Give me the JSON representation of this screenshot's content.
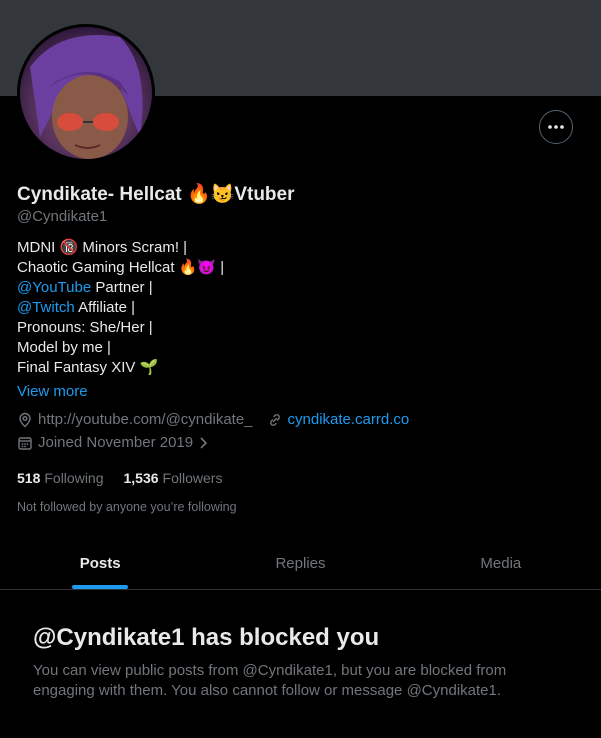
{
  "profile": {
    "display_name": "Cyndikate- Hellcat 🔥😼Vtuber",
    "handle": "@Cyndikate1",
    "bio": {
      "line1": "MDNI 🔞 Minors Scram! |",
      "line2": "Chaotic Gaming Hellcat 🔥😈 |",
      "line3_link": "@YouTube",
      "line3_rest": " Partner |",
      "line4_link": "@Twitch",
      "line4_rest": " Affiliate |",
      "line5": "Pronouns: She/Her |",
      "line6": "Model by me |",
      "line7": "Final Fantasy XIV 🌱"
    },
    "view_more": "View more",
    "website_text": "http://youtube.com/@cyndikate_",
    "link_text": "cyndikate.carrd.co",
    "joined": "Joined November 2019",
    "following_count": "518",
    "following_label": "Following",
    "followers_count": "1,536",
    "followers_label": "Followers",
    "not_followed": "Not followed by anyone you’re following"
  },
  "tabs": [
    {
      "label": "Posts",
      "active": true
    },
    {
      "label": "Replies",
      "active": false
    },
    {
      "label": "Media",
      "active": false
    }
  ],
  "blocked": {
    "title": "@Cyndikate1 has blocked you",
    "message": "You can view public posts from @Cyndikate1, but you are blocked from engaging with them. You also cannot follow or message @Cyndikate1."
  },
  "colors": {
    "accent": "#1d9bf0",
    "banner": "#33373b",
    "muted": "#71767b"
  },
  "icons": [
    "more-icon",
    "location-icon",
    "link-icon",
    "calendar-icon",
    "chevron-right-icon"
  ]
}
